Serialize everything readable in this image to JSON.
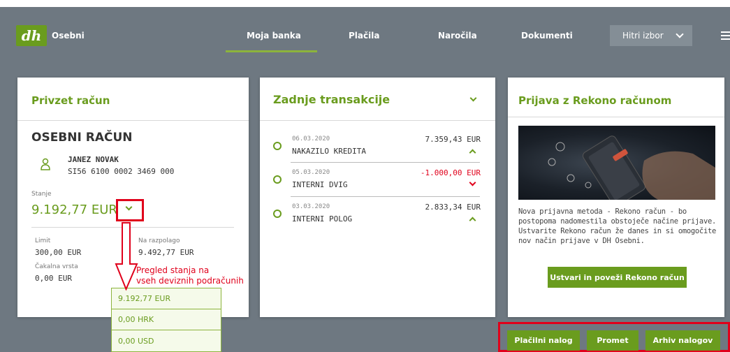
{
  "nav": {
    "brand": "Osebni",
    "items": [
      "Moja banka",
      "Plačila",
      "Naročila",
      "Dokumenti"
    ],
    "quick_select": "Hitri izbor"
  },
  "account_card": {
    "title": "Privzet račun",
    "account_type": "OSEBNI RAČUN",
    "owner_name": "JANEZ NOVAK",
    "iban": "SI56 6100 0002 3469 000",
    "balance_label": "Stanje",
    "balance": "9.192,77 EUR",
    "limit_label": "Limit",
    "limit_value": "300,00 EUR",
    "available_label": "Na razpolago",
    "available_value": "9.492,77 EUR",
    "pending_label": "Čakalna vrsta",
    "pending_value": "0,00 EUR"
  },
  "currency_dropdown": [
    "9.192,77 EUR",
    "0,00 HRK",
    "0,00 USD"
  ],
  "annotation": {
    "line1": "Pregled stanja na",
    "line2": "vseh deviznih podračunih"
  },
  "transactions_card": {
    "title": "Zadnje transakcije",
    "items": [
      {
        "date": "06.03.2020",
        "desc": "NAKAZILO KREDITA",
        "amount": "7.359,43 EUR",
        "direction": "up"
      },
      {
        "date": "05.03.2020",
        "desc": "INTERNI DVIG",
        "amount": "-1.000,00 EUR",
        "direction": "down"
      },
      {
        "date": "03.03.2020",
        "desc": "INTERNI POLOG",
        "amount": "2.833,34 EUR",
        "direction": "up"
      }
    ]
  },
  "rekono_card": {
    "title": "Prijava z Rekono računom",
    "text1": "Nova prijavna metoda - Rekono račun - bo",
    "text2": "postopoma nadomestila obstoječe načine prijave.",
    "text3": "Ustvarite Rekono račun že danes in si omogočite",
    "text4": "nov način prijave v DH Osebni.",
    "button": "Ustvari in poveži Rekono račun"
  },
  "bottom_buttons": [
    "Plačilni nalog",
    "Promet",
    "Arhiv nalogov"
  ],
  "colors": {
    "accent": "#6a9c1e",
    "annotation": "#e0001b",
    "background": "#6e7881"
  }
}
